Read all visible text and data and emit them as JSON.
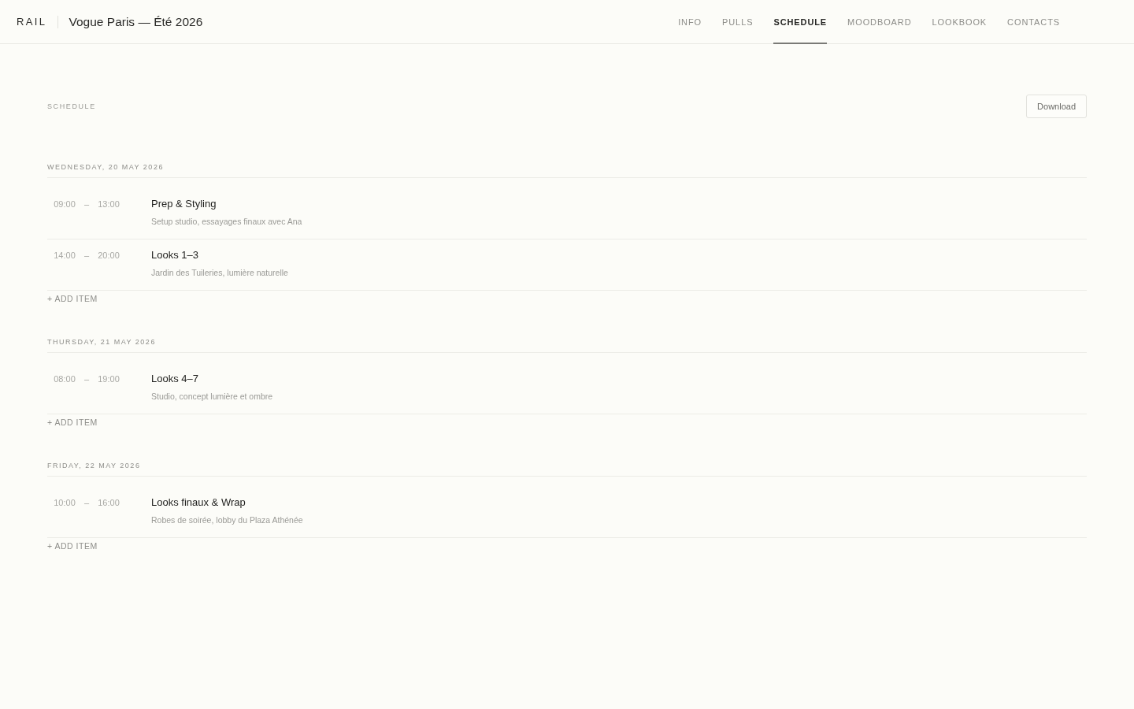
{
  "header": {
    "logo": "RAIL",
    "project_title": "Vogue Paris — Été 2026"
  },
  "tabs": [
    {
      "label": "INFO",
      "selected": false
    },
    {
      "label": "PULLS",
      "selected": false
    },
    {
      "label": "SCHEDULE",
      "selected": true
    },
    {
      "label": "MOODBOARD",
      "selected": false
    },
    {
      "label": "LOOKBOOK",
      "selected": false
    },
    {
      "label": "CONTACTS",
      "selected": false
    }
  ],
  "section": {
    "label": "SCHEDULE",
    "download_button": "Download"
  },
  "days": [
    {
      "date": "WEDNESDAY, 20 MAY 2026",
      "items": [
        {
          "start": "09:00",
          "separator": "–",
          "end": "13:00",
          "title": "Prep & Styling",
          "note": "Setup studio, essayages finaux avec Ana"
        },
        {
          "start": "14:00",
          "separator": "–",
          "end": "20:00",
          "title": "Looks 1–3",
          "note": "Jardin des Tuileries, lumière naturelle"
        }
      ],
      "add_item": "+ ADD ITEM"
    },
    {
      "date": "THURSDAY, 21 MAY 2026",
      "items": [
        {
          "start": "08:00",
          "separator": "–",
          "end": "19:00",
          "title": "Looks 4–7",
          "note": "Studio, concept lumière et ombre"
        }
      ],
      "add_item": "+ ADD ITEM"
    },
    {
      "date": "FRIDAY, 22 MAY 2026",
      "items": [
        {
          "start": "10:00",
          "separator": "–",
          "end": "16:00",
          "title": "Looks finaux & Wrap",
          "note": "Robes de soirée, lobby du Plaza Athénée"
        }
      ],
      "add_item": "+ ADD ITEM"
    }
  ]
}
